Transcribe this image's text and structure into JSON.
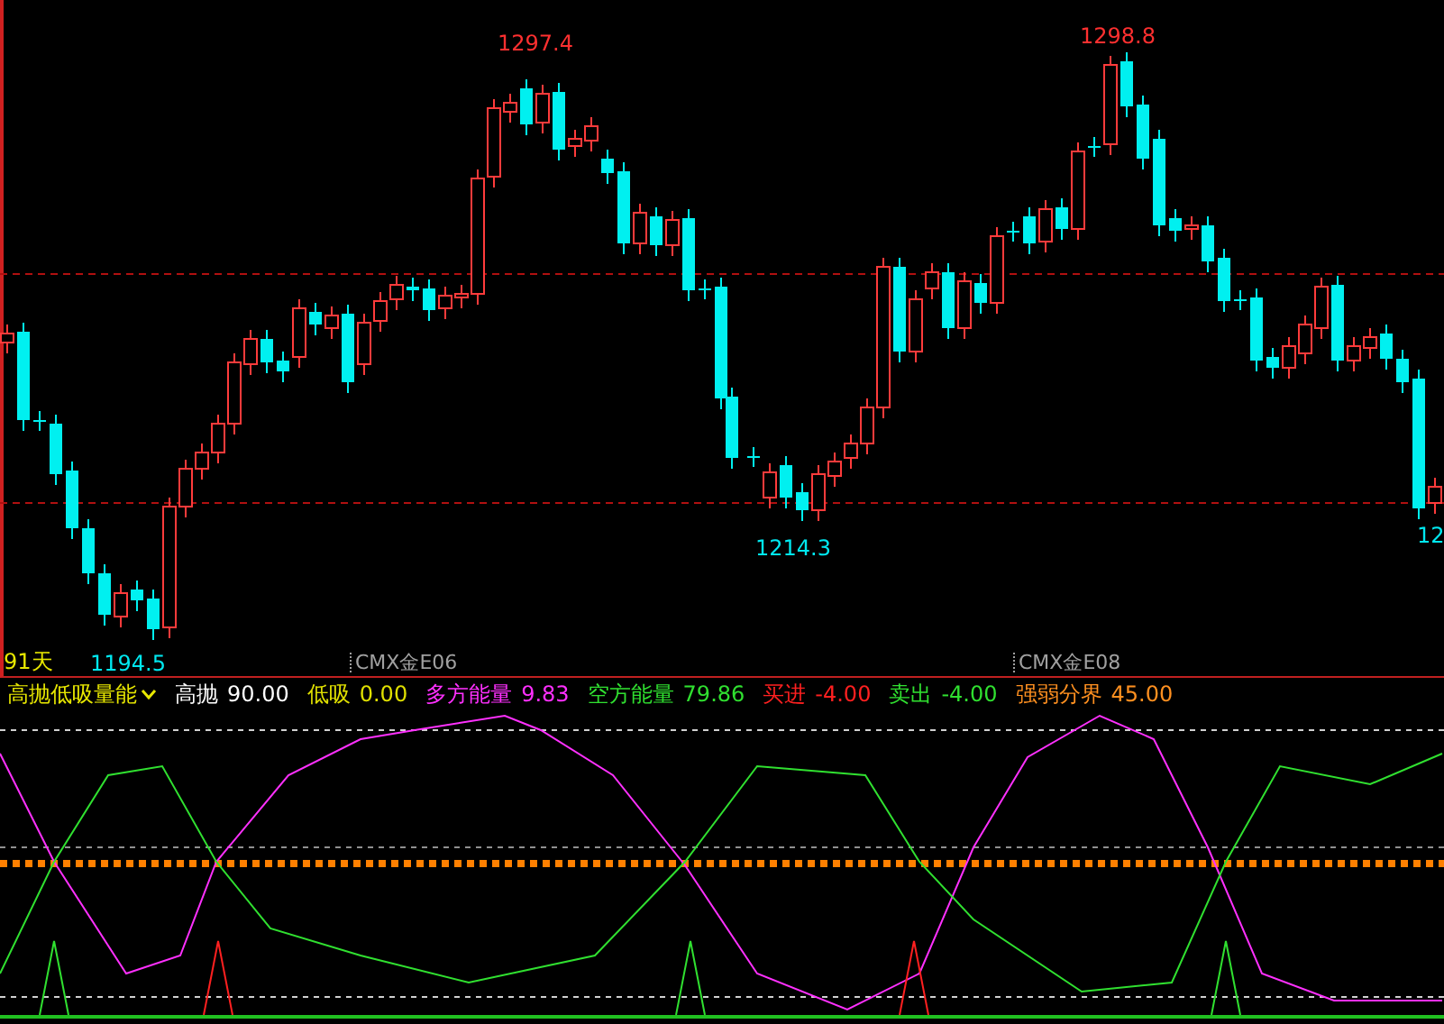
{
  "price_chart": {
    "period_label": "91天",
    "price_labels": [
      {
        "text": "1297.4",
        "kind": "high"
      },
      {
        "text": "1298.8",
        "kind": "high"
      },
      {
        "text": "1194.5",
        "kind": "low"
      },
      {
        "text": "1214.3",
        "kind": "low"
      },
      {
        "text": "12",
        "kind": "low"
      }
    ],
    "contract_labels": [
      "CMX金E06",
      "CMX金E08"
    ]
  },
  "indicator": {
    "name": "高抛低吸量能",
    "values": [
      {
        "label": "高抛",
        "value": "90.00",
        "color": "#ffffff"
      },
      {
        "label": "低吸",
        "value": "0.00",
        "color": "#e0e000"
      },
      {
        "label": "多方能量",
        "value": "9.83",
        "color": "#ff30ff"
      },
      {
        "label": "空方能量",
        "value": "79.86",
        "color": "#30e030"
      },
      {
        "label": "买进",
        "value": "-4.00",
        "color": "#ff2020"
      },
      {
        "label": "卖出",
        "value": "-4.00",
        "color": "#30e030"
      },
      {
        "label": "强弱分界",
        "value": "45.00",
        "color": "#ff9020"
      }
    ]
  }
}
